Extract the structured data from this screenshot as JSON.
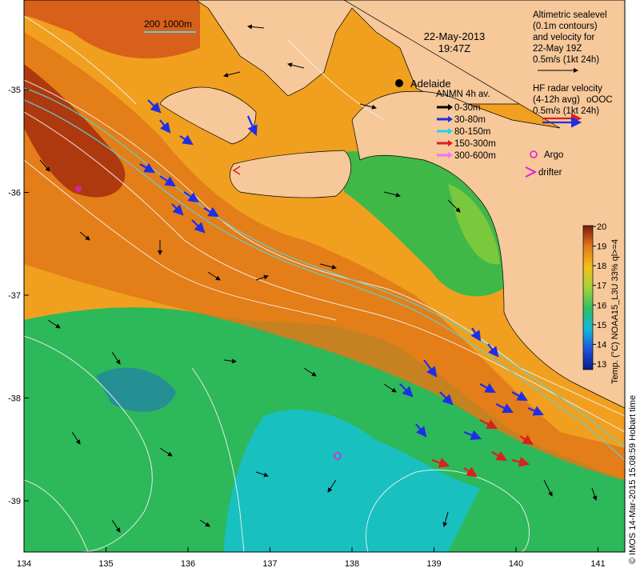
{
  "map": {
    "date": "22-May-2013",
    "time": "19:47Z",
    "scale_label": "200  1000m",
    "place_label": "Adelaide",
    "lon_ticks": [
      "134",
      "135",
      "136",
      "137",
      "138",
      "139",
      "140",
      "141"
    ],
    "lat_ticks": [
      "-35",
      "-36",
      "-37",
      "-38",
      "-39"
    ]
  },
  "legend": {
    "altimetry": {
      "lines": [
        "Altimetric sealevel",
        "(0.1m contours)",
        "and velocity for",
        "22-May 19Z",
        "0.5m/s (1kt 24h)"
      ]
    },
    "hf_radar": {
      "lines": [
        "HF radar velocity",
        "(4-12h avg)",
        "0.5m/s (1kt 24h)"
      ],
      "tag": "oOOC"
    },
    "anmn": {
      "title": "ANMN 4h av.",
      "items": [
        {
          "label": "0-30m",
          "color": "#000000"
        },
        {
          "label": "30-80m",
          "color": "#1e2ee6"
        },
        {
          "label": "80-150m",
          "color": "#22d3ee"
        },
        {
          "label": "150-300m",
          "color": "#dc1f1f"
        },
        {
          "label": "300-600m",
          "color": "#e879f9"
        }
      ]
    },
    "argo": {
      "label": "Argo",
      "color": "#e11fd4"
    },
    "drifter": {
      "label": "drifter",
      "color": "#e11fd4"
    }
  },
  "colorbar": {
    "ticks": [
      "20",
      "19",
      "18",
      "17",
      "16",
      "15",
      "14",
      "13"
    ],
    "label": "Temp. (°C) NOAA15_L3U 33% ql>=4"
  },
  "credit": "© IMOS 14-Mar-2015 15:08:59 Hobart time"
}
